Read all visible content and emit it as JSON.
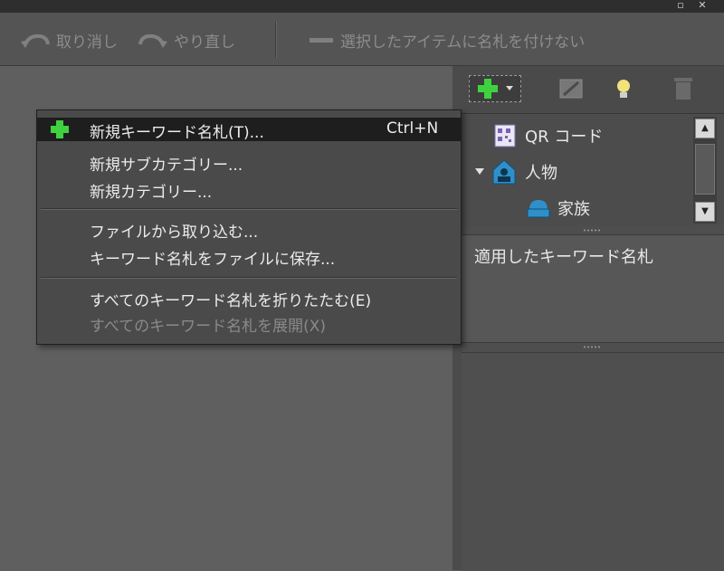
{
  "toolbar": {
    "undo_label": "取り消し",
    "redo_label": "やり直し",
    "untag_label": "選択したアイテムに名札を付けない"
  },
  "context_menu": {
    "items": [
      {
        "label": "新規キーワード名札(T)...",
        "shortcut": "Ctrl+N",
        "icon": "plus-icon",
        "highlighted": true
      },
      {
        "label": "新規サブカテゴリー..."
      },
      {
        "label": "新規カテゴリー..."
      },
      {
        "label": "ファイルから取り込む..."
      },
      {
        "label": "キーワード名札をファイルに保存..."
      },
      {
        "label": "すべてのキーワード名札を折りたたむ(E)"
      },
      {
        "label": "すべてのキーワード名札を展開(X)",
        "disabled": true
      }
    ]
  },
  "keyword_tree": {
    "items": [
      {
        "label": "QR コード",
        "icon": "qr-code-icon"
      },
      {
        "label": "人物",
        "icon": "person-tag-icon",
        "expanded": true
      },
      {
        "label": "家族",
        "icon": "family-tag-icon"
      }
    ]
  },
  "applied_panel": {
    "title": "適用したキーワード名札"
  },
  "colors": {
    "accent_green": "#3fd23f",
    "menu_highlight": "#1e1e1e",
    "panel_bg": "#4e4e4e"
  }
}
